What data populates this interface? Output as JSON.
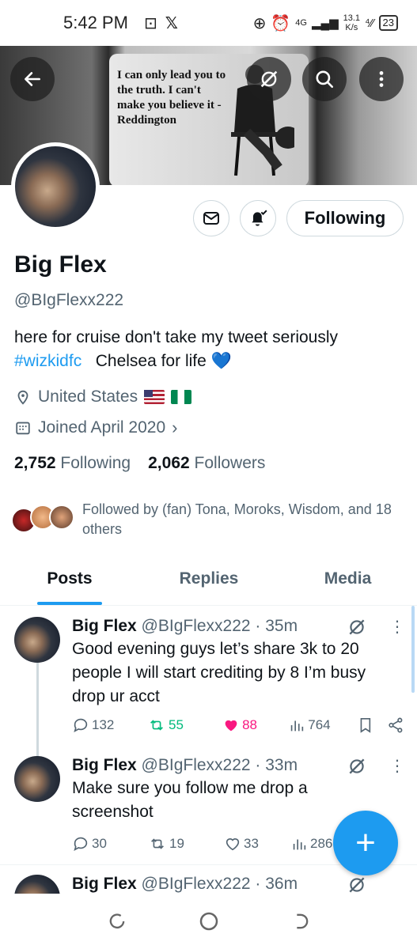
{
  "status_bar": {
    "time": "5:42 PM",
    "net_type": "4G",
    "speed_value": "13.1",
    "speed_unit": "K/s",
    "battery": "23"
  },
  "banner": {
    "quote": "I can only lead you to the truth. I can't make you believe it - Reddington"
  },
  "profile": {
    "name": "Big Flex",
    "handle": "@BIgFlexx222",
    "bio_text": "here for cruise don't take my tweet seriously",
    "bio_hashtag": "#wizkidfc",
    "bio_extra": "Chelsea for life",
    "location": "United States",
    "joined": "Joined April 2020",
    "following_count": "2,752",
    "following_label": "Following",
    "followers_count": "2,062",
    "followers_label": "Followers",
    "followed_by": "Followed by (fan) Tona, Moroks, Wisdom, and 18 others",
    "following_button": "Following"
  },
  "tabs": [
    {
      "label": "Posts",
      "active": true
    },
    {
      "label": "Replies",
      "active": false
    },
    {
      "label": "Media",
      "active": false
    }
  ],
  "tweets": [
    {
      "name": "Big Flex",
      "meta": "@BIgFlexx222 · 35m",
      "text": "Good evening guys let’s share 3k to 20 people I will start crediting by 8 I’m busy drop ur acct",
      "replies": "132",
      "reposts": "55",
      "likes": "88",
      "views": "764"
    },
    {
      "name": "Big Flex",
      "meta": "@BIgFlexx222 · 33m",
      "text": "Make sure you follow me drop a screenshot",
      "replies": "30",
      "reposts": "19",
      "likes": "33",
      "views": "286"
    },
    {
      "name": "Big Flex",
      "meta": "@BIgFlexx222 · 36m"
    }
  ],
  "colors": {
    "accent": "#1d9bf0",
    "repost_active": "#00ba7c",
    "like_active": "#f91880",
    "secondary_text": "#536471"
  }
}
